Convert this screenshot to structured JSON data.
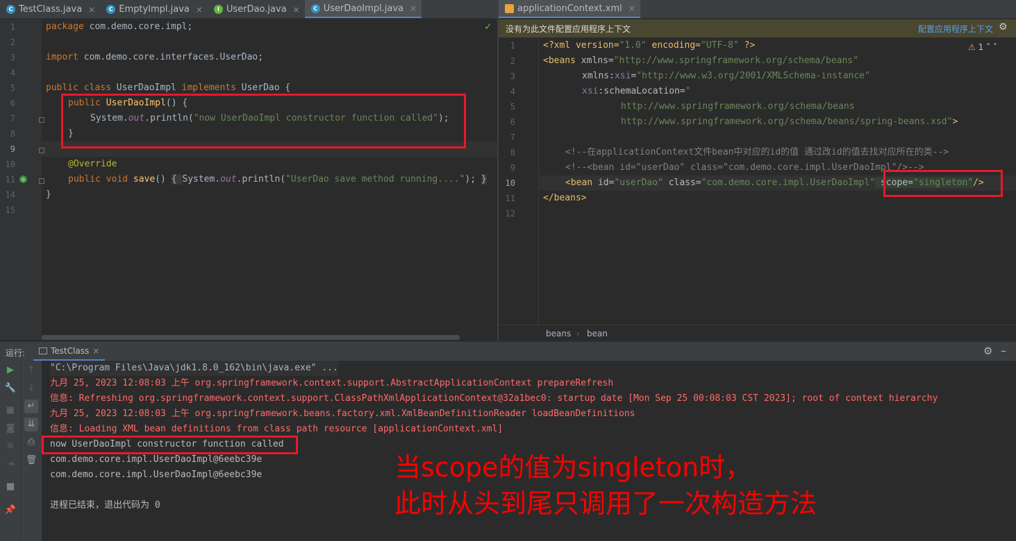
{
  "left_tabs": [
    {
      "label": "TestClass.java",
      "icon": "class-icon",
      "color": "#3592c4"
    },
    {
      "label": "EmptyImpl.java",
      "icon": "class-icon",
      "color": "#3592c4"
    },
    {
      "label": "UserDao.java",
      "icon": "interface-icon",
      "color": "#62b543"
    },
    {
      "label": "UserDaoImpl.java",
      "icon": "class-icon",
      "color": "#3592c4",
      "active": true
    }
  ],
  "right_tabs": [
    {
      "label": "applicationContext.xml",
      "icon": "xml-icon",
      "color": "#e8a33e",
      "active": true
    }
  ],
  "java_editor": {
    "line_numbers": [
      "1",
      "2",
      "3",
      "4",
      "5",
      "6",
      "7",
      "8",
      "9",
      "10",
      "11",
      "14",
      "15"
    ],
    "code": {
      "l1a": "package ",
      "l1b": "com.demo.core.impl;",
      "l3a": "import ",
      "l3b": "com.demo.core.interfaces.UserDao;",
      "l5a": "public class ",
      "l5b": "UserDaoImpl ",
      "l5c": "implements ",
      "l5d": "UserDao {",
      "l6a": "public ",
      "l6b": "UserDaoImpl",
      "l6c": "() {",
      "l7a": "System.",
      "l7b": "out",
      "l7c": ".println(",
      "l7d": "\"now UserDaoImpl constructor function called\"",
      "l7e": ");",
      "l8": "}",
      "l10": "@Override",
      "l11a": "public void ",
      "l11b": "save",
      "l11c": "() ",
      "l11d": "{ ",
      "l11e": "System.",
      "l11f": "out",
      "l11g": ".println(",
      "l11h": "\"UserDao save method running....\"",
      "l11i": "); ",
      "l11j": "}",
      "l14": "}"
    }
  },
  "xml_editor": {
    "banner_text": "没有为此文件配置应用程序上下文",
    "banner_link": "配置应用程序上下文",
    "warning_count": "1",
    "line_numbers": [
      "1",
      "2",
      "3",
      "4",
      "5",
      "6",
      "7",
      "8",
      "9",
      "10",
      "11",
      "12"
    ],
    "code": {
      "x1a": "<?xml version=",
      "x1b": "\"1.0\"",
      "x1c": " encoding=",
      "x1d": "\"UTF-8\"",
      "x1e": " ?>",
      "x2a": "<beans ",
      "x2b": "xmlns=",
      "x2c": "\"http://www.springframework.org/schema/beans\"",
      "x3a": "xmlns:",
      "x3b": "xsi",
      "x3c": "=",
      "x3d": "\"http://www.w3.org/2001/XMLSchema-instance\"",
      "x4a": "xsi",
      "x4b": ":schemaLocation=",
      "x4c": "\"",
      "x5": "http://www.springframework.org/schema/beans",
      "x6a": "http://www.springframework.org/schema/beans/spring-beans.xsd\"",
      "x6b": ">",
      "x8": "<!--在applicationContext文件bean中对应的id的值 通过改id的值去找对应所在的类-->",
      "x9": "<!--<bean id=\"userDao\" class=\"com.demo.core.impl.UserDaoImpl\"/>-->",
      "x10a": "<bean ",
      "x10b": "id=",
      "x10c": "\"userDao\"",
      "x10d": " class=",
      "x10e": "\"com.demo.core.impl.UserDaoImpl\"",
      "x10f": " scope=",
      "x10g": "\"singleton\"",
      "x10h": "/>",
      "x11": "</beans>"
    },
    "breadcrumb": [
      "beans",
      "bean"
    ]
  },
  "run_panel": {
    "label": "运行:",
    "tab": "TestClass",
    "lines": [
      {
        "text": "\"C:\\Program Files\\Java\\jdk1.8.0_162\\bin\\java.exe\" ...",
        "kind": "cmd"
      },
      {
        "text": "九月 25, 2023 12:08:03 上午 org.springframework.context.support.AbstractApplicationContext prepareRefresh",
        "kind": "err"
      },
      {
        "text": "信息: Refreshing org.springframework.context.support.ClassPathXmlApplicationContext@32a1bec0: startup date [Mon Sep 25 00:08:03 CST 2023]; root of context hierarchy",
        "kind": "err"
      },
      {
        "text": "九月 25, 2023 12:08:03 上午 org.springframework.beans.factory.xml.XmlBeanDefinitionReader loadBeanDefinitions",
        "kind": "err"
      },
      {
        "text": "信息: Loading XML bean definitions from class path resource [applicationContext.xml]",
        "kind": "err"
      },
      {
        "text": "now UserDaoImpl constructor function called",
        "kind": "out"
      },
      {
        "text": "com.demo.core.impl.UserDaoImpl@6eebc39e",
        "kind": "out"
      },
      {
        "text": "com.demo.core.impl.UserDaoImpl@6eebc39e",
        "kind": "out"
      },
      {
        "text": "",
        "kind": "out"
      },
      {
        "text": "进程已结束，退出代码为 0",
        "kind": "out"
      }
    ]
  },
  "annotation": {
    "line1": "当scope的值为singleton时，",
    "line2": "此时从头到尾只调用了一次构造方法",
    "color": "#ff0000"
  }
}
